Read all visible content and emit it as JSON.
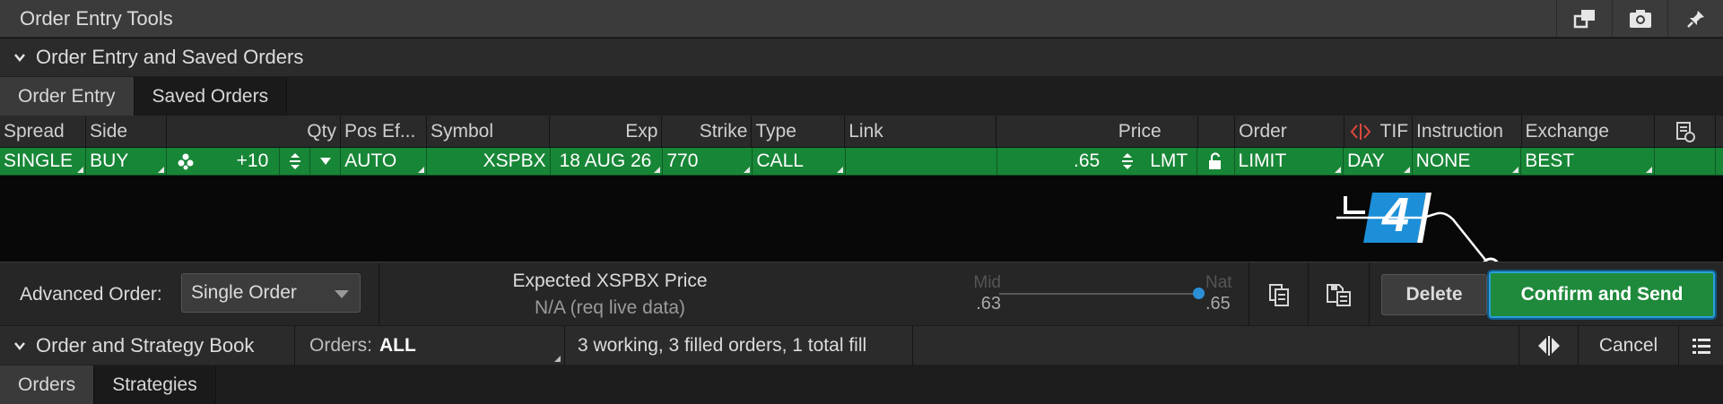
{
  "window": {
    "title": "Order Entry Tools"
  },
  "titlebar_icons": [
    "detach-icon",
    "camera-icon",
    "pin-icon"
  ],
  "section1": {
    "label": "Order Entry and Saved Orders"
  },
  "tabs1": [
    {
      "label": "Order Entry",
      "active": true
    },
    {
      "label": "Saved Orders",
      "active": false
    }
  ],
  "grid": {
    "headers": {
      "spread": "Spread",
      "side": "Side",
      "qty": "Qty",
      "pos_effect": "Pos Ef...",
      "symbol": "Symbol",
      "exp": "Exp",
      "strike": "Strike",
      "type": "Type",
      "link": "Link",
      "price": "Price",
      "order": "Order",
      "tif": "TIF",
      "instruction": "Instruction",
      "exchange": "Exchange"
    },
    "row": {
      "spread": "SINGLE",
      "side": "BUY",
      "qty": "+10",
      "pos_effect": "AUTO",
      "symbol": "XSPBX",
      "exp": "18 AUG 26",
      "strike": "770",
      "type": "CALL",
      "link": "",
      "price": ".65",
      "price_type": "LMT",
      "order": "LIMIT",
      "tif": "DAY",
      "instruction": "NONE",
      "exchange": "BEST"
    }
  },
  "annotation": {
    "step": "4"
  },
  "toolbar": {
    "advanced_label": "Advanced Order:",
    "advanced_value": "Single Order",
    "expected_title": "Expected XSPBX Price",
    "expected_value": "N/A (req live data)",
    "mid_label": "Mid",
    "mid_value": ".63",
    "nat_label": "Nat",
    "nat_value": ".65",
    "delete_label": "Delete",
    "confirm_label": "Confirm and Send"
  },
  "section2": {
    "label": "Order and Strategy Book",
    "orders_label": "Orders:",
    "orders_value": "ALL",
    "summary": "3 working, 3 filled orders, 1 total fill",
    "cancel_label": "Cancel"
  },
  "tabs2": [
    {
      "label": "Orders",
      "active": true
    },
    {
      "label": "Strategies",
      "active": false
    }
  ],
  "colors": {
    "row_green": "#188637",
    "confirm_green": "#1f8a3c",
    "confirm_border": "#2a9fd6",
    "annotation_blue": "#1c8fd8",
    "slider_dot": "#2b8fd6"
  }
}
